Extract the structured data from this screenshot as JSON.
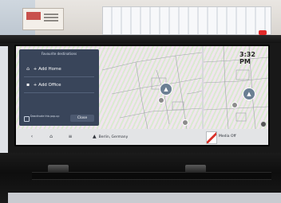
{
  "status": {
    "time": "3:32 PM"
  },
  "panel": {
    "title": "Favourite destinations",
    "items": [
      {
        "label": "+ Add Home",
        "icon": "home-icon"
      },
      {
        "label": "+ Add Office",
        "icon": "briefcase-icon"
      }
    ],
    "deactivate_label": "Deactivate this pop-up",
    "close_label": "Close"
  },
  "bottom_bar": {
    "location": "Berlin, Germany",
    "media_label": "Media Off"
  },
  "colors": {
    "panel_bg": "#39455a",
    "bar_bg": "#e3e4e6",
    "marker": "#6b7f93"
  }
}
